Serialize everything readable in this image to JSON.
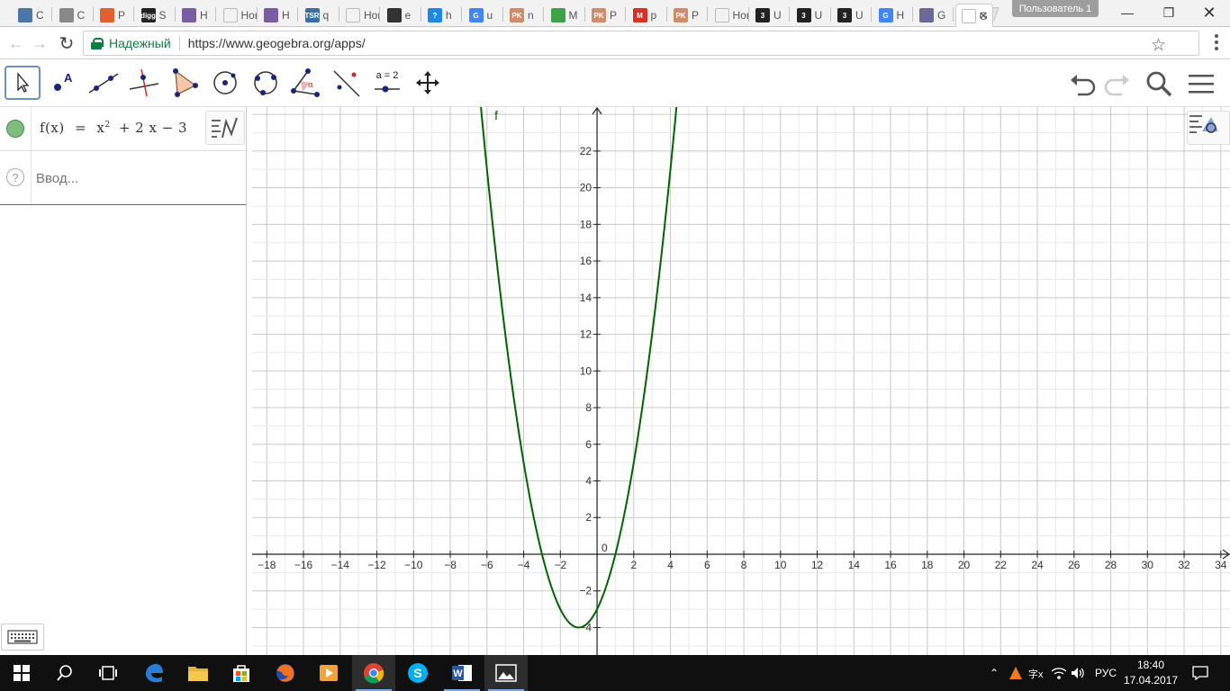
{
  "browser": {
    "tabs": [
      {
        "label": "C",
        "fav": "#4a76a8",
        "glyph": "vk-icon"
      },
      {
        "label": "C",
        "fav": "#888888",
        "glyph": "audio-icon"
      },
      {
        "label": "P",
        "fav": "#e06030",
        "glyph": "color-icon"
      },
      {
        "label": "S",
        "fav": "#222222",
        "glyph": "digg-icon",
        "favtext": "digg"
      },
      {
        "label": "H",
        "fav": "#7b5aa6",
        "glyph": "list-icon"
      },
      {
        "label": "Нова",
        "fav": "",
        "glyph": "blank-icon"
      },
      {
        "label": "H",
        "fav": "#7b5aa6",
        "glyph": "list-icon"
      },
      {
        "label": "q",
        "fav": "#3b6ea8",
        "glyph": "tsr-icon",
        "favtext": "TSR"
      },
      {
        "label": "Нова",
        "fav": "",
        "glyph": "blank-icon"
      },
      {
        "label": "e",
        "fav": "#333333",
        "glyph": "owl-icon"
      },
      {
        "label": "h",
        "fav": "#1e88e5",
        "glyph": "help-icon",
        "favtext": "?"
      },
      {
        "label": "u",
        "fav": "#4285f4",
        "glyph": "google-icon",
        "favtext": "G"
      },
      {
        "label": "n",
        "fav": "#d08b6a",
        "glyph": "pk-icon",
        "favtext": "PK"
      },
      {
        "label": "M",
        "fav": "#3da34a",
        "glyph": "green-ball-icon"
      },
      {
        "label": "P",
        "fav": "#d08b6a",
        "glyph": "pk-icon",
        "favtext": "PK"
      },
      {
        "label": "p",
        "fav": "#d93025",
        "glyph": "gmail-icon",
        "favtext": "M"
      },
      {
        "label": "P",
        "fav": "#d08b6a",
        "glyph": "pk-icon",
        "favtext": "PK"
      },
      {
        "label": "Нова",
        "fav": "",
        "glyph": "blank-icon"
      },
      {
        "label": "U",
        "fav": "#222222",
        "glyph": "three-icon",
        "favtext": "3"
      },
      {
        "label": "U",
        "fav": "#222222",
        "glyph": "three-icon",
        "favtext": "3"
      },
      {
        "label": "U",
        "fav": "#222222",
        "glyph": "three-icon",
        "favtext": "3"
      },
      {
        "label": "H",
        "fav": "#4285f4",
        "glyph": "google-icon",
        "favtext": "G"
      },
      {
        "label": "G",
        "fav": "#6a6a9a",
        "glyph": "geogebra-icon"
      },
      {
        "label": "G",
        "fav": "",
        "glyph": "blank-icon",
        "active": true
      }
    ],
    "user": "Пользователь 1",
    "secure_label": "Надежный",
    "url": "https://www.geogebra.org/apps/"
  },
  "algebra": {
    "function_name": "f",
    "formula_lhs": "f(x)",
    "formula_eq": "=",
    "formula_x": "x",
    "formula_exp": "2",
    "formula_rest": "+ 2 x − 3",
    "input_placeholder": "Ввод..."
  },
  "tools": {
    "equal_label": "a = 2"
  },
  "chart_data": {
    "type": "line",
    "title": "",
    "function": "f(x) = x^2 + 2x - 3",
    "series": [
      {
        "name": "f",
        "color": "#006400",
        "coefficients": {
          "a": 1,
          "b": 2,
          "c": -3
        }
      }
    ],
    "x_ticks": [
      -18,
      -16,
      -14,
      -12,
      -10,
      -8,
      -6,
      -4,
      -2,
      0,
      2,
      4,
      6,
      8,
      10,
      12,
      14,
      16,
      18,
      20,
      22,
      24,
      26,
      28,
      30,
      32,
      34
    ],
    "y_ticks": [
      -4,
      -2,
      0,
      2,
      4,
      6,
      8,
      10,
      12,
      14,
      16,
      18,
      20,
      22
    ],
    "xlim": [
      -18.8,
      34.5
    ],
    "ylim": [
      -5.5,
      24.4
    ],
    "grid": true,
    "roots": [
      -3,
      1
    ],
    "vertex": [
      -1,
      -4
    ]
  },
  "taskbar": {
    "language": "РУС",
    "time": "18:40",
    "date": "17.04.2017"
  }
}
